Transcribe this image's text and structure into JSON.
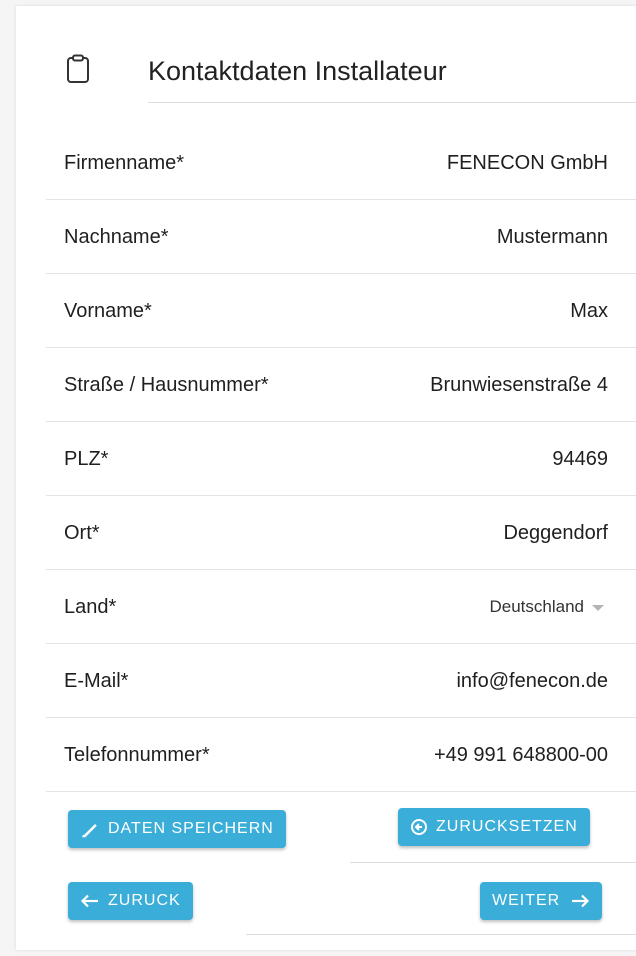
{
  "header": {
    "icon": "clipboard-icon",
    "title": "Kontaktdaten Installateur"
  },
  "fields": [
    {
      "label": "Firmenname*",
      "value": "FENECON GmbH"
    },
    {
      "label": "Nachname*",
      "value": "Mustermann"
    },
    {
      "label": "Vorname*",
      "value": "Max"
    },
    {
      "label": "Straße / Hausnummer*",
      "value": "Brunwiesenstraße 4"
    },
    {
      "label": "PLZ*",
      "value": "94469"
    },
    {
      "label": "Ort*",
      "value": "Deggendorf"
    },
    {
      "label": "Land*",
      "value": "Deutschland"
    },
    {
      "label": "E-Mail*",
      "value": "info@fenecon.de"
    },
    {
      "label": "Telefonnummer*",
      "value": "+49 991 648800-00"
    }
  ],
  "buttons": {
    "save": {
      "label": "DATEN SPEICHERN",
      "icon": "pencil-icon"
    },
    "reset": {
      "label": "ZURUCKSETZEN",
      "icon": "reset-icon"
    },
    "back": {
      "label": "ZURUCK",
      "icon": "arrow-left-icon"
    },
    "next": {
      "label": "WEITER",
      "icon": "arrow-right-icon"
    }
  },
  "colors": {
    "accent": "#3aaed8",
    "divider": "#e3e3e3",
    "text": "#1f1f1f"
  }
}
